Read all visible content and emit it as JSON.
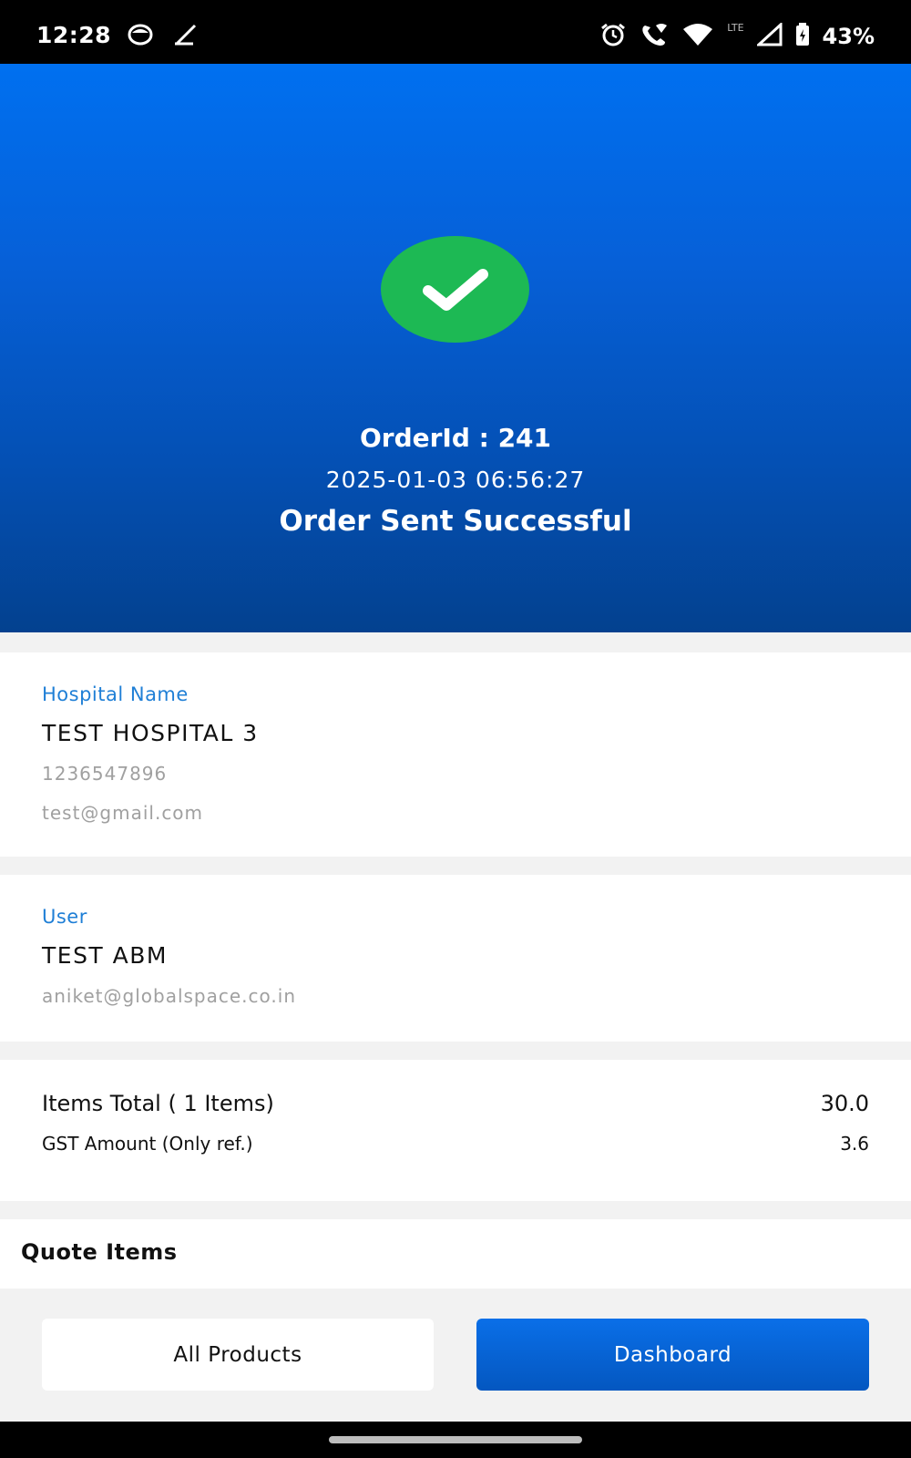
{
  "status_bar": {
    "time": "12:28",
    "battery": "43%",
    "network": "LTE",
    "icons": [
      "notification-icon",
      "pen-icon",
      "alarm-icon",
      "wifi-call-icon",
      "wifi-icon",
      "signal-icon",
      "battery-icon"
    ]
  },
  "hero": {
    "order_id": "OrderId : 241",
    "datetime": "2025-01-03 06:56:27",
    "status": "Order Sent Successful",
    "success_color": "#1db954"
  },
  "hospital": {
    "label": "Hospital Name",
    "name": "TEST HOSPITAL 3",
    "phone": "1236547896",
    "email": "test@gmail.com"
  },
  "user": {
    "label": "User",
    "name": "TEST ABM",
    "email": "aniket@globalspace.co.in"
  },
  "totals": {
    "items_label": "Items Total ( 1 Items)",
    "items_value": "30.0",
    "gst_label": "GST Amount (Only ref.)",
    "gst_value": "3.6"
  },
  "quote": {
    "title": "Quote Items"
  },
  "actions": {
    "all_products": "All Products",
    "dashboard": "Dashboard"
  },
  "colors": {
    "accent": "#1f7fd6",
    "hero_top": "#0070f0",
    "hero_bottom": "#03418f"
  }
}
